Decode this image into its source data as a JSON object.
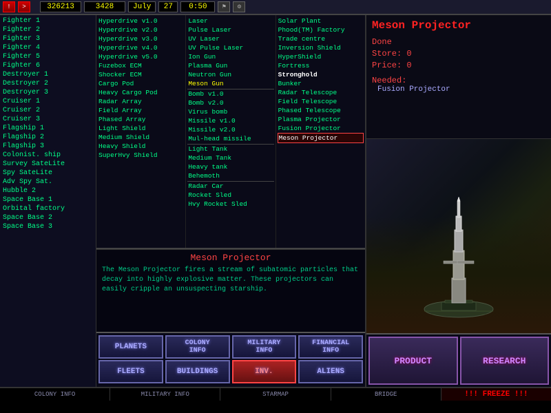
{
  "topbar": {
    "btn1": "!",
    "btn2": ">",
    "credits": "326213",
    "production": "3428",
    "month": "July",
    "day": "27",
    "time": "0:50"
  },
  "ships": [
    {
      "label": "Fighter 1",
      "selected": false
    },
    {
      "label": "Fighter 2",
      "selected": false
    },
    {
      "label": "Fighter 3",
      "selected": false
    },
    {
      "label": "Fighter 4",
      "selected": false
    },
    {
      "label": "Fighter 5",
      "selected": false
    },
    {
      "label": "Fighter 6",
      "selected": false
    },
    {
      "label": "Destroyer 1",
      "selected": false
    },
    {
      "label": "Destroyer 2",
      "selected": false
    },
    {
      "label": "Destroyer 3",
      "selected": false
    },
    {
      "label": "Cruiser 1",
      "selected": false
    },
    {
      "label": "Cruiser 2",
      "selected": false
    },
    {
      "label": "Cruiser 3",
      "selected": false
    },
    {
      "label": "Flagship 1",
      "selected": false
    },
    {
      "label": "Flagship 2",
      "selected": false
    },
    {
      "label": "Flagship 3",
      "selected": false
    },
    {
      "label": "Colonist. ship",
      "selected": false
    },
    {
      "label": "Survey SateLite",
      "selected": false
    },
    {
      "label": "Spy SateLite",
      "selected": false
    },
    {
      "label": "Adv Spy Sat.",
      "selected": false
    },
    {
      "label": "Hubble 2",
      "selected": false
    },
    {
      "label": "Space Base 1",
      "selected": false
    },
    {
      "label": "Orbital factory",
      "selected": false
    },
    {
      "label": "Space Base 2",
      "selected": false
    },
    {
      "label": "Space Base 3",
      "selected": false
    }
  ],
  "equip_col1": [
    {
      "label": "Hyperdrive v1.0",
      "style": "normal"
    },
    {
      "label": "Hyperdrive v2.0",
      "style": "normal"
    },
    {
      "label": "Hyperdrive v3.0",
      "style": "normal"
    },
    {
      "label": "Hyperdrive v4.0",
      "style": "normal"
    },
    {
      "label": "Hyperdrive v5.0",
      "style": "normal"
    },
    {
      "label": "Fuzebox ECM",
      "style": "normal"
    },
    {
      "label": "Shocker ECM",
      "style": "normal"
    },
    {
      "label": "Cargo Pod",
      "style": "normal"
    },
    {
      "label": "Heavy Cargo Pod",
      "style": "normal"
    },
    {
      "label": "Radar Array",
      "style": "normal"
    },
    {
      "label": "Field Array",
      "style": "normal"
    },
    {
      "label": "Phased Array",
      "style": "normal"
    },
    {
      "label": "Light Shield",
      "style": "normal"
    },
    {
      "label": "Medium Shield",
      "style": "normal"
    },
    {
      "label": "Heavy Shield",
      "style": "normal"
    },
    {
      "label": "SuperHvy Shield",
      "style": "normal"
    }
  ],
  "equip_col2": [
    {
      "label": "Laser",
      "style": "normal"
    },
    {
      "label": "Pulse Laser",
      "style": "normal"
    },
    {
      "label": "UV Laser",
      "style": "normal"
    },
    {
      "label": "UV Pulse Laser",
      "style": "normal"
    },
    {
      "label": "Ion Gun",
      "style": "normal"
    },
    {
      "label": "Plasma Gun",
      "style": "normal"
    },
    {
      "label": "Neutron Gun",
      "style": "normal"
    },
    {
      "label": "Meson Gun",
      "style": "yellow"
    },
    {
      "label": "Bomb v1.0",
      "style": "separator"
    },
    {
      "label": "Bomb v2.0",
      "style": "normal"
    },
    {
      "label": "Virus bomb",
      "style": "normal"
    },
    {
      "label": "Missile v1.0",
      "style": "normal"
    },
    {
      "label": "Missile v2.0",
      "style": "normal"
    },
    {
      "label": "Mul-head missile",
      "style": "normal"
    },
    {
      "label": "Light Tank",
      "style": "separator"
    },
    {
      "label": "Medium Tank",
      "style": "normal"
    },
    {
      "label": "Heavy tank",
      "style": "normal"
    },
    {
      "label": "Behemoth",
      "style": "normal"
    },
    {
      "label": "Radar Car",
      "style": "separator"
    },
    {
      "label": "Rocket Sled",
      "style": "normal"
    },
    {
      "label": "Hvy Rocket Sled",
      "style": "normal"
    }
  ],
  "equip_col3": [
    {
      "label": "Solar Plant",
      "style": "normal"
    },
    {
      "label": "Phood(TM) Factory",
      "style": "normal"
    },
    {
      "label": "Trade centre",
      "style": "normal"
    },
    {
      "label": "Inversion Shield",
      "style": "normal"
    },
    {
      "label": "HyperShield",
      "style": "normal"
    },
    {
      "label": "Fortress",
      "style": "normal"
    },
    {
      "label": "Stronghold",
      "style": "bold"
    },
    {
      "label": "Bunker",
      "style": "normal"
    },
    {
      "label": "Radar Telescope",
      "style": "normal"
    },
    {
      "label": "Field Telescope",
      "style": "normal"
    },
    {
      "label": "Phased Telescope",
      "style": "normal"
    },
    {
      "label": "Plasma Projector",
      "style": "normal"
    },
    {
      "label": "Fusion Projector",
      "style": "normal"
    },
    {
      "label": "Meson Projector",
      "style": "selected"
    }
  ],
  "info": {
    "title": "Meson Projector",
    "done_label": "Done",
    "store_label": "Store:",
    "store_value": "0",
    "price_label": "Price:",
    "price_value": "0",
    "needed_label": "Needed:",
    "needed_item": "Fusion Projector"
  },
  "description": {
    "title": "Meson Projector",
    "text": "The Meson Projector fires a stream of subatomic particles that decay into highly explosive matter. These projectors can easily cripple an unsuspecting starship."
  },
  "nav_buttons_row1": [
    {
      "label": "PLANETS",
      "active": false
    },
    {
      "label": "COLONY\nINFO",
      "active": false
    },
    {
      "label": "MILITARY\nINFO",
      "active": false
    },
    {
      "label": "FINANCIAL\nINFO",
      "active": false
    }
  ],
  "nav_buttons_row2": [
    {
      "label": "FLEETS",
      "active": false
    },
    {
      "label": "BUILDINGS",
      "active": false
    },
    {
      "label": "INV.",
      "active": true
    },
    {
      "label": "ALIENS",
      "active": false
    }
  ],
  "right_buttons": [
    {
      "label": "PRODUCT"
    },
    {
      "label": "RESEARCH"
    }
  ],
  "statusbar": [
    {
      "label": "COLONY INFO"
    },
    {
      "label": "MILITARY INFO"
    },
    {
      "label": "STARMAP"
    },
    {
      "label": "BRIDGE"
    },
    {
      "label": "!!! FREEZE !!!",
      "type": "freeze"
    }
  ]
}
